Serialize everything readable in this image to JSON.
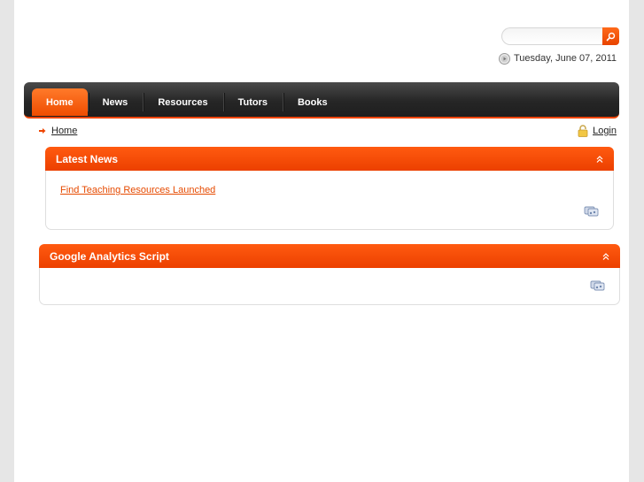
{
  "search": {
    "placeholder": "",
    "value": ""
  },
  "header": {
    "date": "Tuesday, June 07, 2011"
  },
  "nav": {
    "items": [
      {
        "label": "Home",
        "active": true
      },
      {
        "label": "News"
      },
      {
        "label": "Resources"
      },
      {
        "label": "Tutors"
      },
      {
        "label": "Books"
      }
    ]
  },
  "breadcrumb": {
    "home": "Home"
  },
  "login": {
    "label": "Login"
  },
  "modules": {
    "latest_news": {
      "title": "Latest News",
      "link": "Find Teaching Resources Launched"
    },
    "analytics": {
      "title": "Google Analytics Script"
    }
  },
  "colors": {
    "accent": "#ee4400",
    "nav_dark": "#262626"
  },
  "icons": [
    "search-icon",
    "clock-icon",
    "arrow-right-icon",
    "lock-icon",
    "collapse-up-icon",
    "feed-icon"
  ]
}
